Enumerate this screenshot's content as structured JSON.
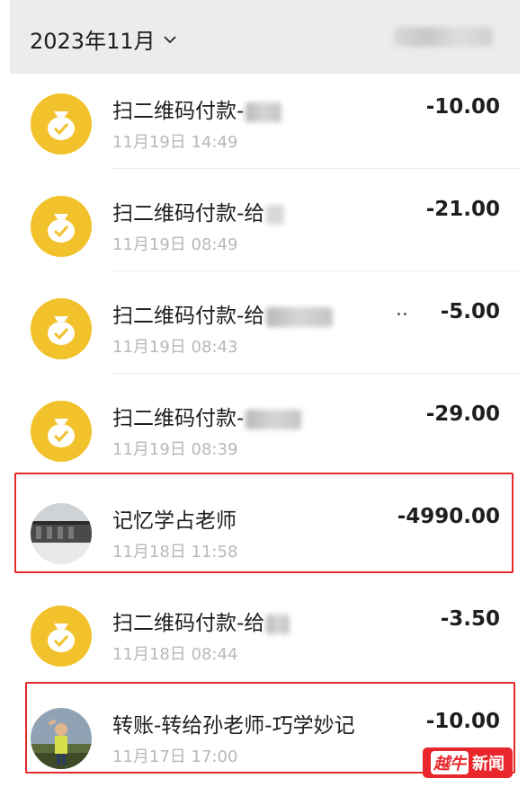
{
  "header": {
    "month_label": "2023年11月",
    "chevron_icon": "chevron-down-icon"
  },
  "transactions": [
    {
      "title": "扫二维码付款-",
      "time": "11月19日 14:49",
      "amount": "-10.00",
      "icon": "money-bag-icon"
    },
    {
      "title": "扫二维码付款-给",
      "time": "11月19日 08:49",
      "amount": "-21.00",
      "icon": "money-bag-icon"
    },
    {
      "title": "扫二维码付款-给",
      "time": "11月19日 08:43",
      "amount": "-5.00",
      "icon": "money-bag-icon",
      "trailing": ".."
    },
    {
      "title": "扫二维码付款-",
      "time": "11月19日 08:39",
      "amount": "-29.00",
      "icon": "money-bag-icon"
    },
    {
      "title": "记忆学占老师",
      "time": "11月18日 11:58",
      "amount": "-4990.00",
      "icon": "avatar",
      "highlighted": true
    },
    {
      "title": "扫二维码付款-给",
      "time": "11月18日 08:44",
      "amount": "-3.50",
      "icon": "money-bag-icon"
    },
    {
      "title": "转账-转给孙老师-巧学妙记",
      "time": "11月17日 17:00",
      "amount": "-10.00",
      "icon": "avatar",
      "highlighted": true
    }
  ],
  "watermark": {
    "logo": "越牛",
    "label": "新闻"
  },
  "colors": {
    "icon_yellow": "#f1c22b",
    "highlight_red": "#e22a2a",
    "watermark_red": "#e8262b"
  }
}
